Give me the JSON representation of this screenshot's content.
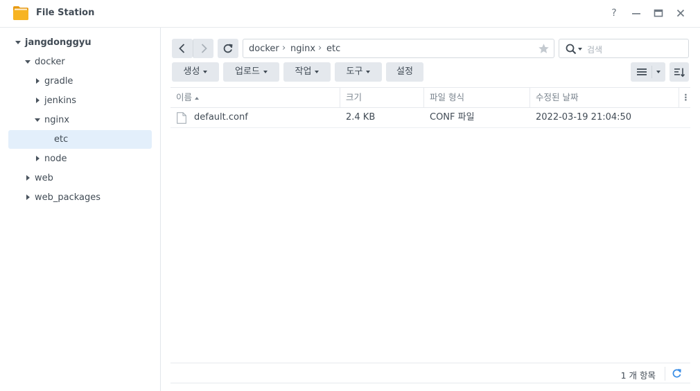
{
  "window": {
    "title": "File Station",
    "controls": [
      "help-icon",
      "minimize-icon",
      "maximize-icon",
      "close-icon"
    ],
    "help_label": "?"
  },
  "sidebar": {
    "tree": [
      {
        "label": "jangdonggyu",
        "state": "expanded",
        "root": true
      },
      {
        "label": "docker",
        "state": "expanded"
      },
      {
        "label": "gradle",
        "state": "collapsed"
      },
      {
        "label": "jenkins",
        "state": "collapsed"
      },
      {
        "label": "nginx",
        "state": "expanded"
      },
      {
        "label": "etc",
        "state": "leaf",
        "selected": true
      },
      {
        "label": "node",
        "state": "collapsed"
      },
      {
        "label": "web",
        "state": "collapsed"
      },
      {
        "label": "web_packages",
        "state": "collapsed"
      }
    ]
  },
  "toolbar": {
    "back_icon": "chevron-left-icon",
    "forward_icon": "chevron-right-icon",
    "refresh_icon": "refresh-icon",
    "path": [
      "docker",
      "nginx",
      "etc"
    ],
    "favorite_icon": "star-icon",
    "search_placeholder": "검색",
    "create_label": "생성",
    "upload_label": "업로드",
    "action_label": "작업",
    "tools_label": "도구",
    "settings_label": "설정",
    "view_icon": "list-view-icon",
    "sort_icon": "sort-icon"
  },
  "table": {
    "columns": [
      "이름",
      "크기",
      "파일 형식",
      "수정된 날짜"
    ],
    "rows": [
      {
        "name": "default.conf",
        "size": "2.4 KB",
        "type": "CONF 파일",
        "modified": "2022-03-19 21:04:50"
      }
    ]
  },
  "footer": {
    "item_count": "1 개 항목"
  },
  "colors": {
    "accent": "#3a8ee6",
    "selected_bg": "#e3effb",
    "button_bg": "#e4e8ed",
    "folder": "#f7b422"
  }
}
